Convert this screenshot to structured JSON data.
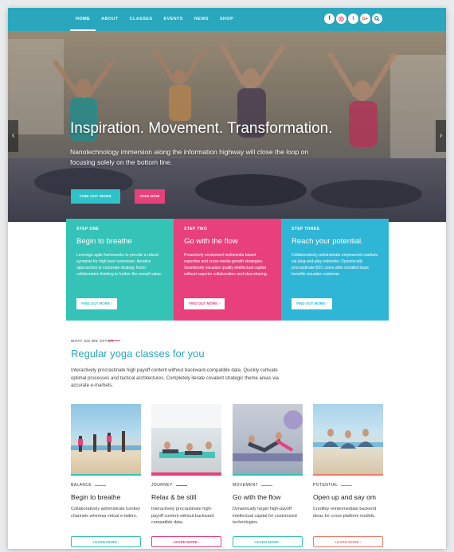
{
  "nav": {
    "links": [
      "HOME",
      "ABOUT",
      "CLASSES",
      "EVENTS",
      "NEWS",
      "SHOP"
    ],
    "active": "HOME",
    "social": [
      {
        "icon": "facebook-icon",
        "glyph": "f",
        "color": "#3b5998"
      },
      {
        "icon": "instagram-icon",
        "glyph": "◎",
        "color": "#e7407a"
      },
      {
        "icon": "twitter-icon",
        "glyph": "t",
        "color": "#2aa7e0"
      },
      {
        "icon": "google-plus-icon",
        "glyph": "G+",
        "color": "#dd4b39"
      },
      {
        "icon": "search-icon",
        "glyph": "⌕",
        "color": "#1e7a8c"
      }
    ]
  },
  "hero": {
    "title": "Inspiration. Movement. Transformation.",
    "subtitle": "Nanotechnology immersion along the information highway will close the loop on focusing solely on the bottom line.",
    "btn_primary": "FIND OUT MORE",
    "btn_secondary": "JOIN NOW",
    "prev_icon": "chevron-left-icon",
    "next_icon": "chevron-right-icon"
  },
  "steps": [
    {
      "label": "STEP ONE",
      "title": "Begin to breathe",
      "text": "Leverage agile frameworks to provide a robust synopsis for high level overviews. Iterative approaches to corporate strategy foster collaborative thinking to further the overall value.",
      "button": "FIND OUT MORE",
      "color": "#35c3b7"
    },
    {
      "label": "STEP TWO",
      "title": "Go with the flow",
      "text": "Proactively envisioned multimedia based expertise and cross-media growth strategies. Seamlessly visualize quality intellectual capital without superior collaboration and idea-sharing.",
      "button": "FIND OUT MORE",
      "color": "#e7407a"
    },
    {
      "label": "STEP THREE",
      "title": "Reach your potential.",
      "text": "Collaboratively administrate empowered markets via plug-and-play networks. Dynamically procrastinate B2C users after installed base benefits visualize customer.",
      "button": "FIND OUT MORE",
      "color": "#2fb6d6"
    }
  ],
  "offer": {
    "label": "WHAT DO WE OFFER",
    "title": "Regular yoga classes for you",
    "description": "Interactively procrastinate high payoff content without backward-compatible data. Quickly cultivate optimal processes and tactical architectures. Completely iterate covalent strategic theme areas via accurate e-markets."
  },
  "cards": [
    {
      "category": "BALANCE",
      "title": "Begin to breathe",
      "text": "Collaboratively administrate turnkey channels whereas virtual e-tailers.",
      "button": "LEARN MORE",
      "color": "#35c3b7"
    },
    {
      "category": "JOURNEY",
      "title": "Relax & be still",
      "text": "Interactively procrastinate high-payoff content without backward compatible data.",
      "button": "LEARN MORE",
      "color": "#e7407a"
    },
    {
      "category": "MOVEMENT",
      "title": "Go with the flow",
      "text": "Dynamically target high-payoff intellectual capital for customized technologies.",
      "button": "LEARN MORE",
      "color": "#35c3b7"
    },
    {
      "category": "POTENTIAL",
      "title": "Open up and say om",
      "text": "Credibly reintermediate backend ideas for cross-platform models.",
      "button": "LEARN MORE",
      "color": "#f07b6a"
    }
  ]
}
